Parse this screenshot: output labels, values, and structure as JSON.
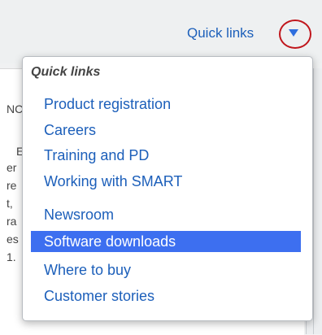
{
  "header": {
    "quick_links_label": "Quick links"
  },
  "dropdown": {
    "title": "Quick links",
    "items": [
      {
        "label": "Product registration"
      },
      {
        "label": "Careers"
      },
      {
        "label": "Training and PD"
      },
      {
        "label": "Working with SMART"
      },
      {
        "label": "Newsroom"
      },
      {
        "label": "Software downloads",
        "highlighted": true
      },
      {
        "label": "Where to buy"
      },
      {
        "label": "Customer stories"
      }
    ]
  },
  "background_text_fragments": [
    "NC",
    "E",
    "er",
    "re",
    "t,",
    "ra",
    "es",
    "1."
  ],
  "colors": {
    "link": "#1c5fba",
    "highlight": "#3d6ff0",
    "annotation_ring": "#c0161c"
  },
  "icons": {
    "dropdown_toggle": "chevron-down-icon"
  }
}
